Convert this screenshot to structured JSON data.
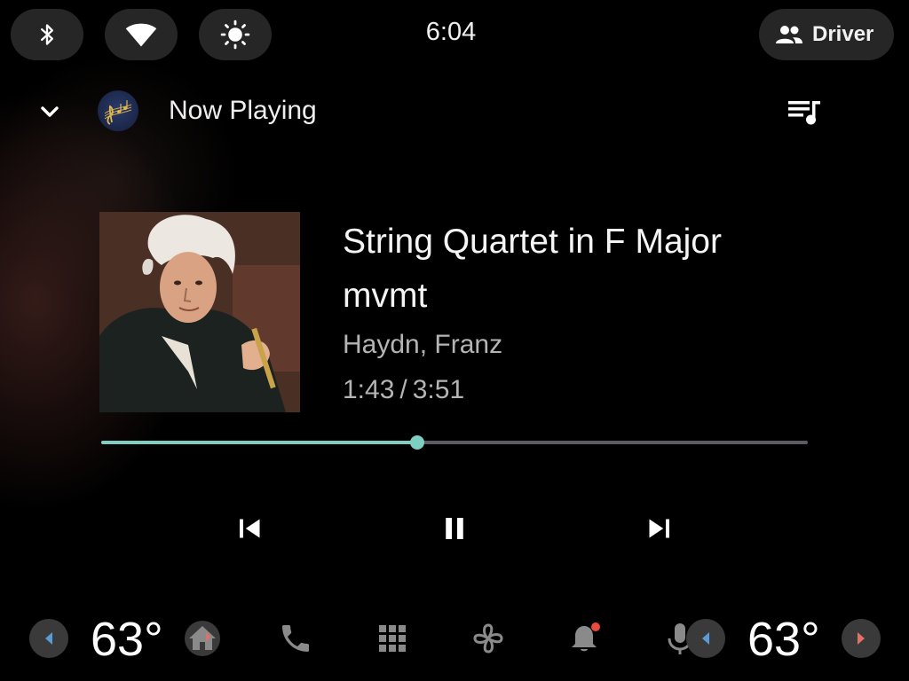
{
  "status_bar": {
    "time": "6:04",
    "profile_label": "Driver",
    "icons": [
      "bluetooth-icon",
      "wifi-icon",
      "brightness-icon",
      "people-icon"
    ]
  },
  "header": {
    "title": "Now Playing",
    "collapse_icon": "chevron-down-icon",
    "queue_icon": "queue-music-icon"
  },
  "track": {
    "title": "String Quartet in F Major mvmt",
    "artist": "Haydn, Franz",
    "elapsed": "1:43",
    "separator": "/",
    "duration": "3:51",
    "progress_fraction": 0.447
  },
  "controls": {
    "icons": [
      "skip-previous-icon",
      "pause-icon",
      "skip-next-icon"
    ]
  },
  "bottom_nav": {
    "temp_left": "63°",
    "temp_right": "63°",
    "icons": [
      "home-icon",
      "phone-icon",
      "apps-grid-icon",
      "fan-icon",
      "notification-bell-icon",
      "microphone-icon"
    ],
    "notification_badge": true
  },
  "colors": {
    "accent": "#7ecec2",
    "track_unfilled": "#5c5a62",
    "pill_bg": "#262626",
    "secondary_text": "#b4b4b4",
    "badge": "#e84a3d",
    "temp_left_arrow": "#5b9bd5",
    "temp_right_arrow": "#e0706a"
  }
}
